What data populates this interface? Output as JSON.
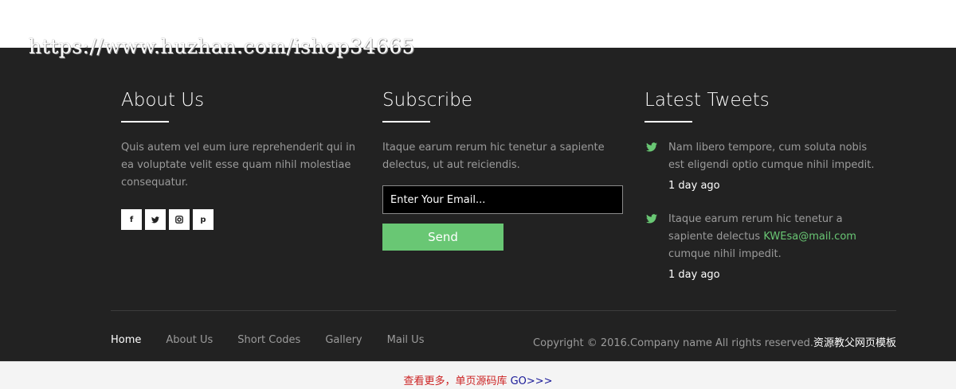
{
  "watermark": "https://www.huzhan.com/ishop34665",
  "about": {
    "title": "About Us",
    "text": "Quis autem vel eum iure reprehenderit qui in ea voluptate velit esse quam nihil molestiae consequatur.",
    "social": [
      {
        "icon": "facebook-icon",
        "glyph": "f"
      },
      {
        "icon": "twitter-icon",
        "glyph": "t"
      },
      {
        "icon": "instagram-icon",
        "glyph": "◙"
      },
      {
        "icon": "pinterest-icon",
        "glyph": "p"
      }
    ]
  },
  "subscribe": {
    "title": "Subscribe",
    "text": "Itaque earum rerum hic tenetur a sapiente delectus, ut aut reiciendis.",
    "email_placeholder": "Enter Your Email...",
    "send_label": "Send"
  },
  "tweets": {
    "title": "Latest Tweets",
    "items": [
      {
        "text": "Nam libero tempore, cum soluta nobis est eligendi optio cumque nihil impedit.",
        "time": "1 day ago"
      },
      {
        "text_before": "Itaque earum rerum hic tenetur a sapiente delectus ",
        "link": "KWEsa@mail.com",
        "text_after": " cumque nihil impedit.",
        "time": "1 day ago"
      }
    ]
  },
  "nav": [
    "Home",
    "About Us",
    "Short Codes",
    "Gallery",
    "Mail Us"
  ],
  "copyright": {
    "text": "Copyright © 2016.Company name All rights reserved.",
    "cn": "资源教父网页模板"
  },
  "bottom": {
    "more": "查看更多，单页源码库 ",
    "go": "GO>>>"
  },
  "colors": {
    "footer_bg": "#222222",
    "accent": "#69c774",
    "muted_text": "#9b9b9b"
  }
}
